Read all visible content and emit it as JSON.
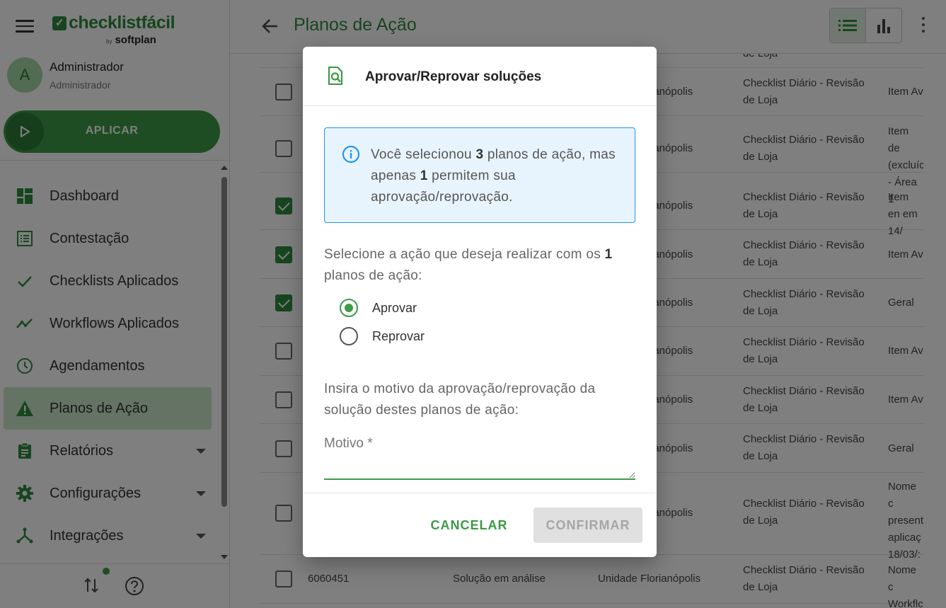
{
  "sidebar": {
    "brand": {
      "name": "checklistfácil",
      "by": "by",
      "company": "softplan"
    },
    "user": {
      "initial": "A",
      "name": "Administrador",
      "role": "Administrador"
    },
    "apply_label": "APLICAR",
    "items": [
      {
        "label": "Dashboard",
        "icon": "dashboard-icon"
      },
      {
        "label": "Contestação",
        "icon": "list-icon"
      },
      {
        "label": "Checklists Aplicados",
        "icon": "check-icon"
      },
      {
        "label": "Workflows Aplicados",
        "icon": "trend-icon"
      },
      {
        "label": "Agendamentos",
        "icon": "clock-icon"
      },
      {
        "label": "Planos de Ação",
        "icon": "warning-icon",
        "active": true
      },
      {
        "label": "Relatórios",
        "icon": "clipboard-icon",
        "expandable": true
      },
      {
        "label": "Configurações",
        "icon": "gear-icon",
        "expandable": true
      },
      {
        "label": "Integrações",
        "icon": "hub-icon",
        "expandable": true
      }
    ]
  },
  "header": {
    "title": "Planos de Ação"
  },
  "table": {
    "rows": [
      {
        "checked": false,
        "id": "",
        "status": "",
        "unit": "",
        "checklist": "",
        "item": ""
      },
      {
        "checked": false,
        "id": "",
        "status": "",
        "unit": "rianópolis",
        "checklist": "Checklist Diário - Revisão de Loja",
        "item": "Item Av"
      },
      {
        "checked": false,
        "id": "",
        "status": "",
        "unit": "rianópolis",
        "checklist": "Checklist Diário - Revisão de Loja",
        "item": "Item de (excluíc - Área 1"
      },
      {
        "checked": true,
        "id": "",
        "status": "",
        "unit": "rianópolis",
        "checklist": "Checklist Diário - Revisão de Loja",
        "item": "Item en em 14/"
      },
      {
        "checked": true,
        "id": "",
        "status": "",
        "unit": "rianópolis",
        "checklist": "Checklist Diário - Revisão de Loja",
        "item": "Item Av"
      },
      {
        "checked": true,
        "id": "",
        "status": "",
        "unit": "rianópolis",
        "checklist": "Checklist Diário - Revisão de Loja",
        "item": "Geral"
      },
      {
        "checked": false,
        "id": "",
        "status": "",
        "unit": "rianópolis",
        "checklist": "Checklist Diário - Revisão de Loja",
        "item": "Item Av"
      },
      {
        "checked": false,
        "id": "",
        "status": "",
        "unit": "rianópolis",
        "checklist": "Checklist Diário - Revisão de Loja",
        "item": "Item Av"
      },
      {
        "checked": false,
        "id": "",
        "status": "",
        "unit": "rianópolis",
        "checklist": "Checklist Diário - Revisão de Loja",
        "item": "Geral"
      },
      {
        "checked": false,
        "id": "",
        "status": "",
        "unit": "rianópolis",
        "checklist": "Checklist Diário - Revisão de Loja",
        "item": "Nome c present aplicaç 18/03/:"
      },
      {
        "checked": false,
        "id": "6060451",
        "status": "Solução em análise",
        "unit": "Unidade Florianópolis",
        "checklist": "Checklist Diário - Revisão de Loja",
        "item": "Nome c Workflc"
      }
    ],
    "top_partial_text": "de Loja"
  },
  "dialog": {
    "title": "Aprovar/Reprovar soluções",
    "info_pre": "Você selecionou ",
    "info_selected": "3",
    "info_mid": " planos de ação, mas apenas ",
    "info_allowed": "1",
    "info_post": " permitem sua aprovação/reprovação.",
    "select_pre": "Selecione a ação que deseja realizar com os ",
    "select_count": "1",
    "select_post": " planos de ação:",
    "options": [
      {
        "label": "Aprovar",
        "selected": true
      },
      {
        "label": "Reprovar",
        "selected": false
      }
    ],
    "reason_text": "Insira o motivo da aprovação/reprovação da solução destes planos de ação:",
    "reason_placeholder": "Motivo *",
    "reason_value": "",
    "cancel_label": "CANCELAR",
    "confirm_label": "CONFIRMAR"
  },
  "colors": {
    "brand_green": "#3d9a47",
    "title_green": "#2e8b3e",
    "info_border": "#2196f3",
    "info_bg": "#e8f4fd",
    "disabled_bg": "#e0e0e0"
  }
}
